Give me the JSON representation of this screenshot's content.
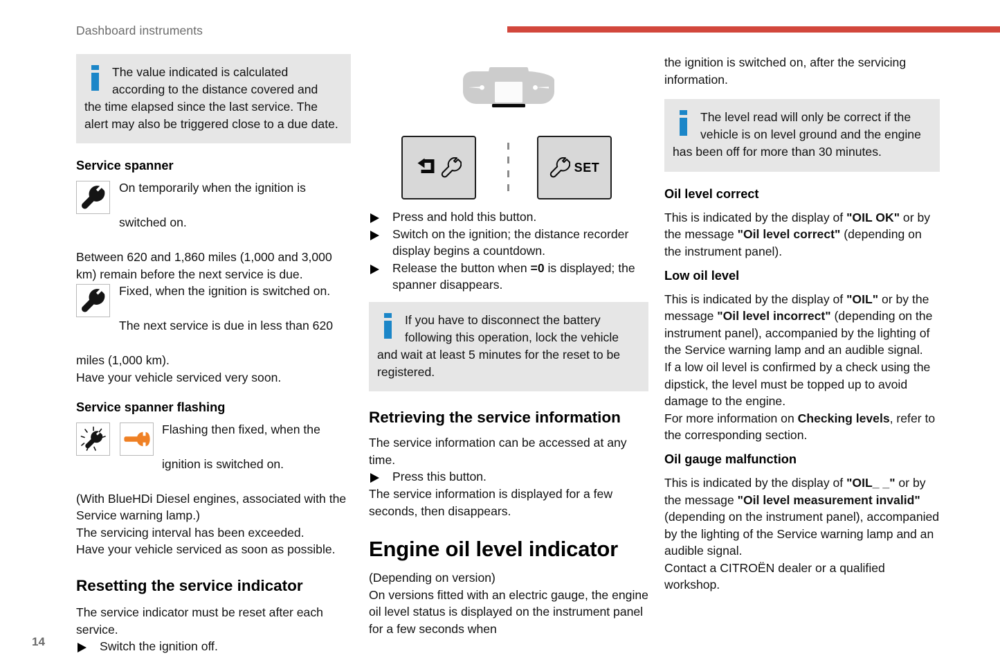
{
  "header": {
    "title": "Dashboard instruments",
    "rule_color": "#d2473c"
  },
  "page_number": "14",
  "colors": {
    "info_box_bg": "#e6e6e6",
    "info_icon_blue": "#1b86c8",
    "accent_red": "#d2473c",
    "orange_spanner": "#ef8024"
  },
  "left_column": {
    "info_box_1": {
      "line1": "The value indicated is calculated",
      "line2": "according to the distance covered and",
      "rest": "the time elapsed since the last service. The alert may also be triggered close to a due date."
    },
    "heading_service_spanner": "Service spanner",
    "spanner_fixed_text_line1": "On temporarily when the ignition is",
    "spanner_fixed_text_line2": "switched on.",
    "between_text": "Between 620 and 1,860 miles (1,000 and 3,000 km) remain before the next service is due.",
    "spanner_fixed2_line1": "Fixed, when the ignition is switched on.",
    "spanner_fixed2_line2": "The next service is due in less than 620",
    "miles_text": "miles (1,000 km).",
    "serviced_soon": "Have your vehicle serviced very soon.",
    "heading_flashing": "Service spanner flashing",
    "flashing_line1": "Flashing then fixed, when the",
    "flashing_line2": "ignition is switched on.",
    "bluehdi_text": "(With BlueHDi Diesel engines, associated with the Service warning lamp.)",
    "interval_exceeded": "The servicing interval has been exceeded.",
    "serviced_asap": "Have your vehicle serviced as soon as possible.",
    "heading_resetting": "Resetting the service indicator",
    "reset_text": "The service indicator must be reset after each service.",
    "reset_step_1": "Switch the ignition off."
  },
  "middle_column": {
    "illustration": {
      "instrument_cluster": "instrument-cluster",
      "left_button_icons": "return-arrow-and-spanner",
      "right_button_icon": "spanner",
      "right_button_label": "SET"
    },
    "step_1": "Press and hold this button.",
    "step_2": "Switch on the ignition; the distance recorder display begins a countdown.",
    "step_3_a": "Release the button when ",
    "step_3_b": "=0",
    "step_3_c": " is displayed; the spanner disappears.",
    "info_box_2": {
      "line1": "If you have to disconnect the battery",
      "line2": "following this operation, lock the vehicle",
      "rest": "and wait at least 5 minutes for the reset to be registered."
    },
    "heading_retrieving": "Retrieving the service information",
    "retrieving_text": "The service information can be accessed at any time.",
    "retrieving_step": "Press this button.",
    "retrieving_after": "The service information is displayed for a few seconds, then disappears.",
    "heading_engine_oil": "Engine oil level indicator",
    "depending_on_version": "(Depending on version)",
    "oil_intro": "On versions fitted with an electric gauge, the engine oil level status is displayed on the instrument panel for a few seconds when"
  },
  "right_column": {
    "continuation": "the ignition is switched on, after the servicing information.",
    "info_box_3": {
      "line1": "The level read will only be correct if the",
      "line2": "vehicle is on level ground and the engine",
      "rest": "has been off for more than 30 minutes."
    },
    "heading_oil_correct": "Oil level correct",
    "oil_correct_p1": "This is indicated by the display of ",
    "oil_correct_b1": "\"OIL OK\"",
    "oil_correct_p2": " or by the message ",
    "oil_correct_b2": "\"Oil level correct\"",
    "oil_correct_p3": " (depending on the instrument panel).",
    "heading_low_oil": "Low oil level",
    "low_oil_p1": "This is indicated by the display of ",
    "low_oil_b1": "\"OIL\"",
    "low_oil_p2": " or by the message ",
    "low_oil_b2": "\"Oil level incorrect\"",
    "low_oil_p3": " (depending on the instrument panel), accompanied by the lighting of the Service warning lamp and an audible signal.",
    "low_oil_p4": "If a low oil level is confirmed by a check using the dipstick, the level must be topped up to avoid damage to the engine.",
    "low_oil_p5a": "For more information on ",
    "low_oil_b3": "Checking levels",
    "low_oil_p5b": ", refer to the corresponding section.",
    "heading_malfunction": "Oil gauge malfunction",
    "malfunction_p1": "This is indicated by the display of ",
    "malfunction_b1": "\"OIL_ _\"",
    "malfunction_p2": " or by the message ",
    "malfunction_b2": "\"Oil level measurement invalid\"",
    "malfunction_p3": " (depending on the instrument panel), accompanied by the lighting of the Service warning lamp and an audible signal.",
    "malfunction_p4": "Contact a CITROËN dealer or a qualified workshop."
  }
}
